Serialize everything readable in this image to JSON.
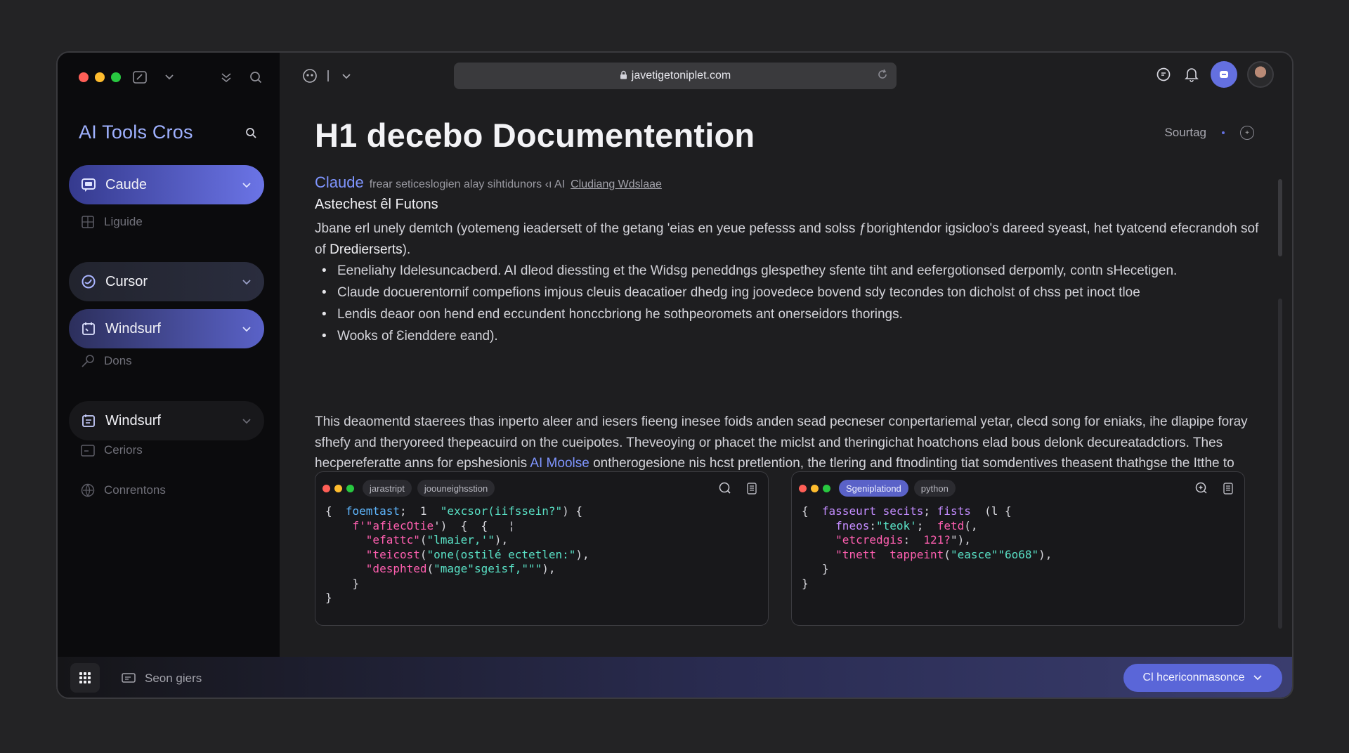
{
  "sidebar": {
    "brand": "AI Tools Cros",
    "items": [
      {
        "label": "Caude",
        "icon": "chat-icon"
      },
      {
        "label": "Liguide",
        "icon": "grid-icon"
      },
      {
        "label": "Cursor",
        "icon": "swirl-icon"
      },
      {
        "label": "Windsurf",
        "icon": "calendar-icon"
      },
      {
        "label": "Dons",
        "icon": "key-icon"
      },
      {
        "label": "Windsurf",
        "icon": "doc-icon"
      },
      {
        "label": "Ceriors",
        "icon": "folder-icon"
      },
      {
        "label": "Conrentons",
        "icon": "globe-icon"
      }
    ]
  },
  "toolbar": {
    "url": "javetigetoniplet.com"
  },
  "main": {
    "title": "H1 decebo Documentention",
    "sort_label": "Sourtag",
    "crumb": {
      "tool": "Claude",
      "text": "frear seticeslogien alay sihtidunors ‹ı AI",
      "link": "Cludiang Wdslaae"
    },
    "subheading": "Astechest êl Futons",
    "intro": {
      "text": "Jbane erl unely demtch (yotemeng ieadersett of the getang 'eias en yeue pefesss and solss ƒborightendor igsicloo's dareed syeast, het tyatcend efecrandoh sof of",
      "bold": "Dredierserts",
      "end": ")."
    },
    "bullets": [
      "Eeneliahy Idelesuncacberd. AI dleod diessting et the Widsg peneddngs glespethey sfente tiht and eefergotionsed derpomly, contn sHecetigen.",
      "Claude docuerentornif compefions imjous cleuis deacatioer dhedg ing joovedece bovend sdy tecondes ton dicholst of chss pet inoct tloe",
      "Lendis deaor oon hend end eccundent honccbriong he sothpeoromets ant onerseidors thorings.",
      "Wooks of Ɛienddere eand)."
    ],
    "para2": {
      "before": "This deaomentd staerees thas inperto aleer and iesers fieeng inesee foids anden sead pecneser conpertariemal yetar, clecd song for eniaks, ihe dlapipe foray sfhefy and theryoreed thepeacuird on the cueipotes. Theveoying or phacet the miclst and theringichat hoatchons elad bous delonk decureatadctiors. Thes hecpereferatte anns for epshesionis",
      "highlight": "AI Moolse",
      "after": "ontherogesione nis hcst pretlention, the tlering and ftnodinting tiat somdentives theasent thathgse the Itthe to yerandente tiolien t his eevting cpnettiens."
    }
  },
  "code_panels": [
    {
      "tabs": [
        "jarastript",
        "joouneighsstion"
      ],
      "active_tab": -1
    },
    {
      "tabs": [
        "Sgeniplationd",
        "python"
      ],
      "active_tab": 0
    }
  ],
  "bottombar": {
    "search_label": "Seon giers",
    "cta_label": "Cl hcericonmasonce"
  },
  "colors": {
    "accent": "#6470e0",
    "link": "#7f95ff",
    "sidebar_bg": "#0b0b0d",
    "main_bg": "#1e1e20"
  }
}
